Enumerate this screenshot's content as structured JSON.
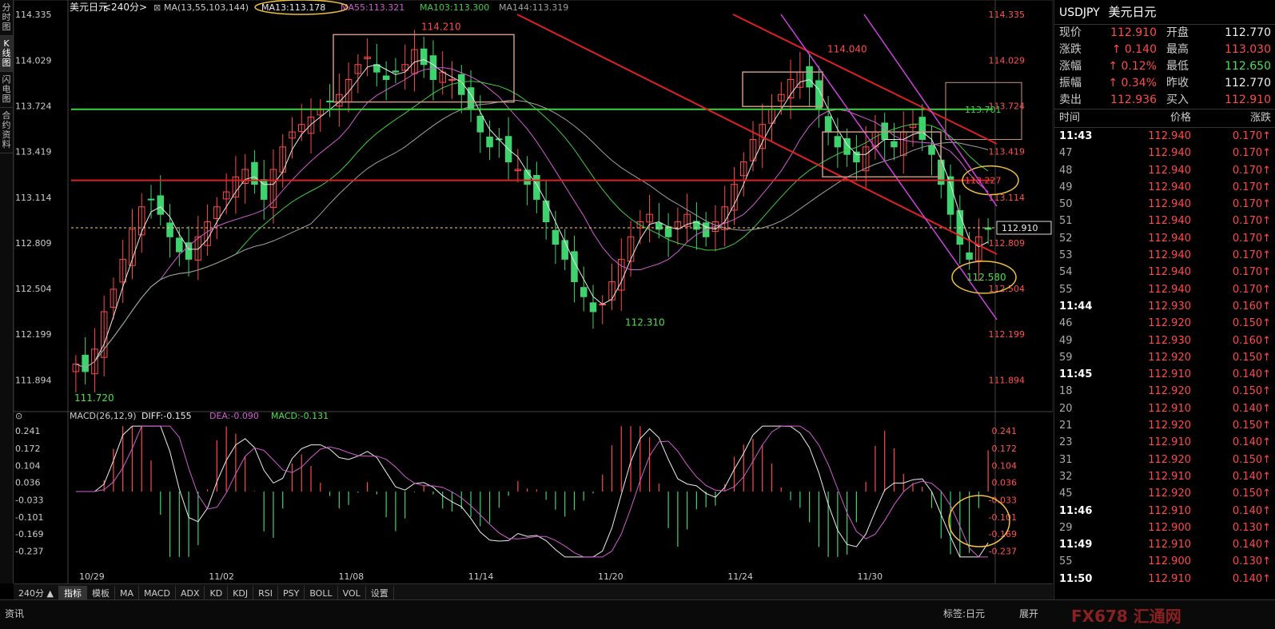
{
  "left_tabs": [
    "分时图",
    "K线图",
    "闪电图",
    "合约资料"
  ],
  "chart_data": {
    "type": "candlestick",
    "title": "美元日元",
    "period": "<240分>",
    "ma_header": {
      "label": "MA(13,55,103,144)",
      "values": [
        {
          "name": "MA13",
          "value": "113.178",
          "color": "#e8e8e8"
        },
        {
          "name": "MA55",
          "value": "113.321",
          "color": "#d25cd2"
        },
        {
          "name": "MA103",
          "value": "113.300",
          "color": "#3fcf3f"
        },
        {
          "name": "MA144",
          "value": "113.319",
          "color": "#a0a0a0"
        }
      ]
    },
    "ylim": [
      111.72,
      114.335
    ],
    "yticks": [
      "114.335",
      "114.029",
      "113.724",
      "113.419",
      "113.114",
      "112.809",
      "112.504",
      "112.199",
      "111.894"
    ],
    "xticks": [
      "10/29",
      "11/02",
      "11/08",
      "11/14",
      "11/20",
      "11/24",
      "11/30"
    ],
    "current_price": "112.910",
    "hlines": [
      {
        "value": 113.701,
        "color": "#3fd13f",
        "label": "113.701"
      },
      {
        "value": 113.227,
        "color": "#e02020",
        "label": "113.227"
      }
    ],
    "price_annotations": [
      "114.210",
      "114.040",
      "111.720",
      "112.310",
      "112.580"
    ],
    "close_path": [
      112.0,
      111.95,
      112.1,
      112.35,
      112.5,
      112.7,
      112.9,
      113.05,
      113.1,
      113.0,
      112.85,
      112.75,
      112.7,
      112.85,
      112.95,
      113.05,
      113.15,
      113.25,
      113.3,
      113.2,
      113.1,
      113.3,
      113.45,
      113.55,
      113.6,
      113.65,
      113.7,
      113.75,
      113.8,
      113.9,
      114.0,
      114.05,
      113.95,
      113.9,
      113.95,
      114.0,
      114.1,
      114.0,
      113.9,
      113.95,
      113.9,
      113.8,
      113.7,
      113.55,
      113.45,
      113.5,
      113.35,
      113.3,
      113.2,
      113.1,
      112.95,
      112.8,
      112.7,
      112.55,
      112.45,
      112.35,
      112.4,
      112.55,
      112.7,
      112.85,
      112.95,
      113.0,
      112.9,
      112.85,
      112.95,
      113.0,
      112.9,
      112.85,
      112.95,
      113.05,
      113.2,
      113.35,
      113.5,
      113.6,
      113.7,
      113.8,
      113.9,
      113.95,
      113.85,
      113.7,
      113.55,
      113.45,
      113.4,
      113.35,
      113.45,
      113.55,
      113.5,
      113.45,
      113.55,
      113.6,
      113.5,
      113.4,
      113.2,
      113.0,
      112.8,
      112.7,
      112.85,
      112.9
    ],
    "macd": {
      "label": "MACD(26,12,9)",
      "diff": "DIFF:-0.155",
      "dea": "DEA:-0.090",
      "macd": "MACD:-0.131",
      "ylim": [
        -0.27,
        0.27
      ],
      "yticks": [
        "0.241",
        "0.172",
        "0.104",
        "0.036",
        "-0.033",
        "-0.101",
        "-0.169",
        "-0.237"
      ]
    }
  },
  "right_panel": {
    "symbol": "USDJPY",
    "name": "美元日元",
    "quotes": [
      {
        "l1": "现价",
        "v1": "112.910",
        "c1": "red",
        "l2": "开盘",
        "v2": "112.770",
        "c2": "white"
      },
      {
        "l1": "涨跌",
        "v1": "↑ 0.140",
        "c1": "red",
        "l2": "最高",
        "v2": "113.030",
        "c2": "red"
      },
      {
        "l1": "涨幅",
        "v1": "↑ 0.12%",
        "c1": "red",
        "l2": "最低",
        "v2": "112.650",
        "c2": "green"
      },
      {
        "l1": "振幅",
        "v1": "↑ 0.34%",
        "c1": "red",
        "l2": "昨收",
        "v2": "112.770",
        "c2": "white"
      },
      {
        "l1": "卖出",
        "v1": "112.936",
        "c1": "red",
        "l2": "买入",
        "v2": "112.910",
        "c2": "red"
      }
    ],
    "headers": [
      "时间",
      "价格",
      "涨跌"
    ],
    "ticks": [
      {
        "t": "11:43",
        "p": "112.940",
        "c": "0.170↑",
        "b": true
      },
      {
        "t": "47",
        "p": "112.940",
        "c": "0.170↑"
      },
      {
        "t": "48",
        "p": "112.940",
        "c": "0.170↑"
      },
      {
        "t": "49",
        "p": "112.940",
        "c": "0.170↑"
      },
      {
        "t": "50",
        "p": "112.940",
        "c": "0.170↑"
      },
      {
        "t": "51",
        "p": "112.940",
        "c": "0.170↑"
      },
      {
        "t": "52",
        "p": "112.940",
        "c": "0.170↑"
      },
      {
        "t": "53",
        "p": "112.940",
        "c": "0.170↑"
      },
      {
        "t": "54",
        "p": "112.940",
        "c": "0.170↑"
      },
      {
        "t": "55",
        "p": "112.940",
        "c": "0.170↑"
      },
      {
        "t": "11:44",
        "p": "112.930",
        "c": "0.160↑",
        "b": true
      },
      {
        "t": "46",
        "p": "112.920",
        "c": "0.150↑"
      },
      {
        "t": "49",
        "p": "112.930",
        "c": "0.160↑"
      },
      {
        "t": "59",
        "p": "112.920",
        "c": "0.150↑"
      },
      {
        "t": "11:45",
        "p": "112.910",
        "c": "0.140↑",
        "b": true
      },
      {
        "t": "18",
        "p": "112.920",
        "c": "0.150↑"
      },
      {
        "t": "20",
        "p": "112.910",
        "c": "0.140↑"
      },
      {
        "t": "21",
        "p": "112.920",
        "c": "0.150↑"
      },
      {
        "t": "23",
        "p": "112.910",
        "c": "0.140↑"
      },
      {
        "t": "31",
        "p": "112.920",
        "c": "0.150↑"
      },
      {
        "t": "32",
        "p": "112.910",
        "c": "0.140↑"
      },
      {
        "t": "45",
        "p": "112.920",
        "c": "0.150↑"
      },
      {
        "t": "11:46",
        "p": "112.910",
        "c": "0.140↑",
        "b": true
      },
      {
        "t": "29",
        "p": "112.900",
        "c": "0.130↑"
      },
      {
        "t": "11:49",
        "p": "112.910",
        "c": "0.140↑",
        "b": true
      },
      {
        "t": "55",
        "p": "112.900",
        "c": "0.130↑"
      },
      {
        "t": "11:50",
        "p": "112.910",
        "c": "0.140↑",
        "b": true
      }
    ]
  },
  "bottom_tabs": [
    "指标",
    "模板",
    "MA",
    "MACD",
    "ADX",
    "KD",
    "KDJ",
    "RSI",
    "PSY",
    "BOLL",
    "VOL",
    "设置"
  ],
  "period_selector": "240分 ▲",
  "status": {
    "left": "资讯",
    "tag": "标签:日元",
    "expand": "展开",
    "ctrl": "▲ ▼",
    "watermark": "FX678 汇通网"
  }
}
